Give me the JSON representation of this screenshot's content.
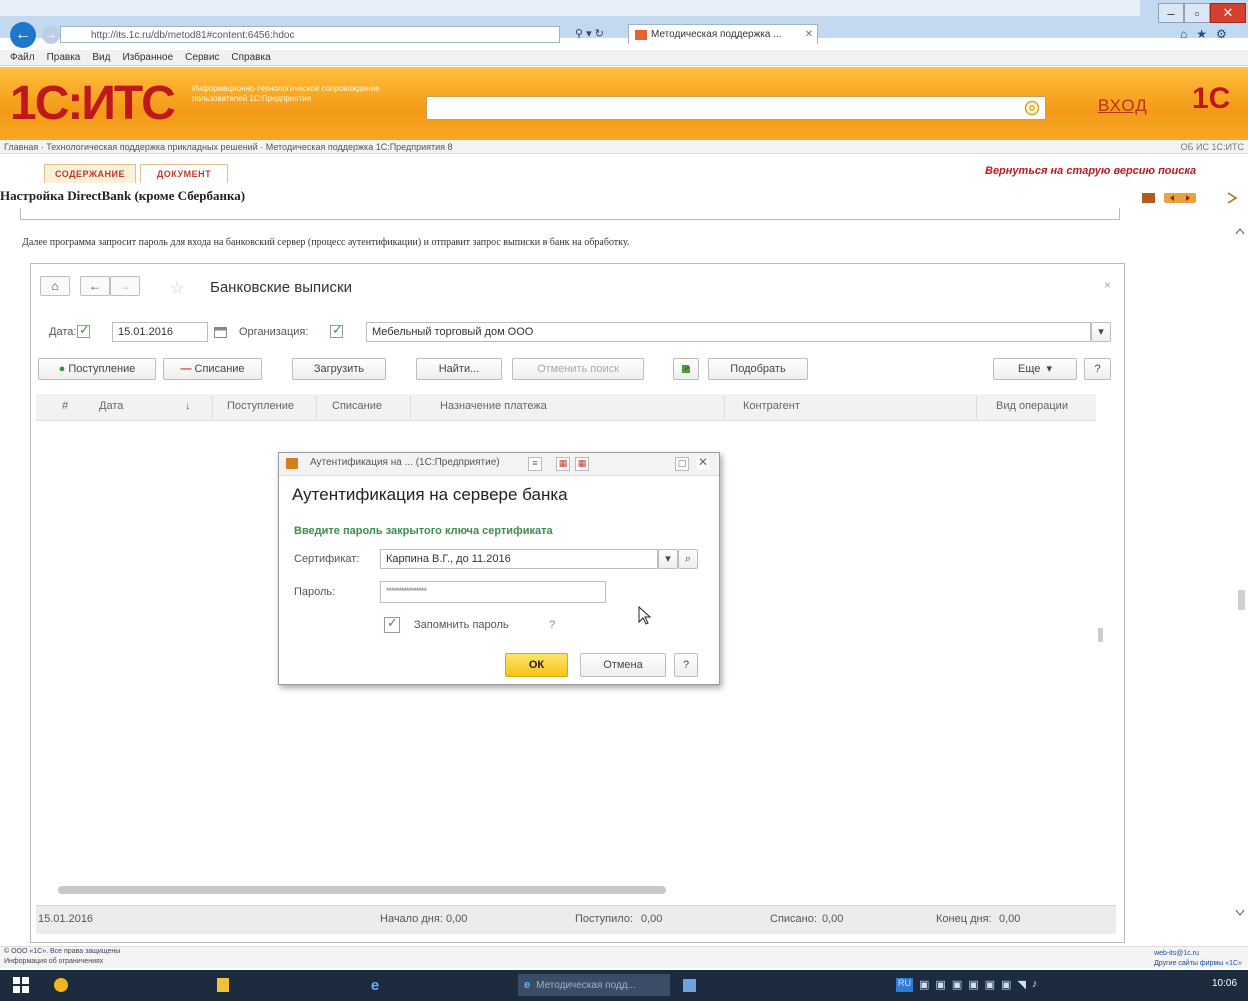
{
  "browser": {
    "address": "http://its.1c.ru/db/metod81#content:6456:hdoc",
    "tab_title": "Методическая поддержка ...",
    "menu": [
      "Файл",
      "Правка",
      "Вид",
      "Избранное",
      "Сервис",
      "Справка"
    ],
    "window_min": "–",
    "window_max": "▫",
    "window_close": "✕"
  },
  "its": {
    "logo": "1С:ИТС",
    "logo_subtitle": "Информационно-технологическое сопровождение пользователей 1С:Предприятия",
    "login": "ВХОД",
    "brand_mini": "1С",
    "breadcrumbs": "Главная  ·  Технологическая поддержка прикладных решений  ·  Методическая поддержка 1С:Предприятия 8",
    "breadcrumbs_right": "ОБ ИС 1С:ИТС",
    "tabs": [
      "СОДЕРЖАНИЕ",
      "ДОКУМЕНТ"
    ],
    "return_link": "Вернуться на старую версию поиска",
    "doc_title": "Настройка DirectBank (кроме Сбербанка)",
    "doc_text": "Далее программа запросит пароль для входа на банковский сервер (процесс аутентификации) и отправит запрос выписки в банк на обработку."
  },
  "form": {
    "title": "Банковские выписки",
    "date_label": "Дата:",
    "date_value": "15.01.2016",
    "org_label": "Организация:",
    "org_value": "Мебельный торговый дом ООО",
    "buttons": {
      "incoming": "Поступление",
      "outgoing": "Списание",
      "load": "Загрузить",
      "find": "Найти...",
      "cancel_search": "Отменить поиск",
      "pick": "Подобрать",
      "more": "Еще",
      "help": "?"
    },
    "columns": [
      "Дата",
      "Поступление",
      "Списание",
      "Назначение платежа",
      "Контрагент",
      "Вид операции"
    ],
    "footer": {
      "date": "15.01.2016",
      "start_label": "Начало дня:",
      "start_value": "0,00",
      "in_label": "Поступило:",
      "in_value": "0,00",
      "out_label": "Списано:",
      "out_value": "0,00",
      "end_label": "Конец дня:",
      "end_value": "0,00"
    }
  },
  "dialog": {
    "caption": "Аутентификация на ... (1С:Предприятие)",
    "title": "Аутентификация на сервере банка",
    "hint": "Введите пароль закрытого ключа сертификата",
    "cert_label": "Сертификат:",
    "cert_value": "Карпина В.Г., до 11.2016",
    "pwd_label": "Пароль:",
    "pwd_value": "****************",
    "remember_label": "Запомнить пароль",
    "remember_help": "?",
    "ok": "ОК",
    "cancel": "Отмена",
    "help": "?"
  },
  "legal": {
    "left": "© ООО «1С». Все права защищены\nИнформация об ограничениях",
    "right": "web-its@1c.ru\nДругие сайты фирмы «1С»"
  },
  "taskbar": {
    "active_window": "Методическая подд...",
    "lang": "RU",
    "clock": "10:06"
  },
  "colors": {
    "accent_orange": "#f39a18",
    "brand_red": "#c0171d",
    "ok_yellow": "#f5c518",
    "hint_green": "#3a8f4a"
  }
}
